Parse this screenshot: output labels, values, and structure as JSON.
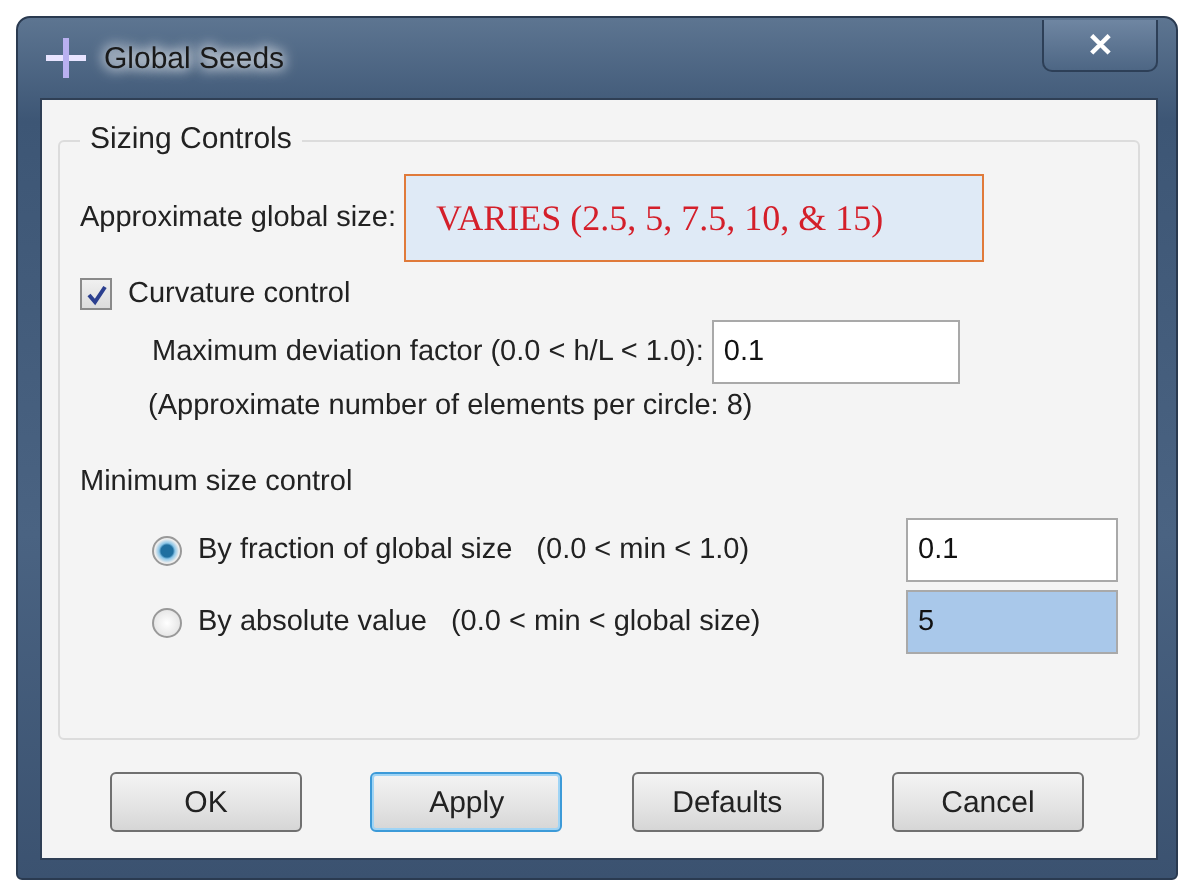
{
  "window": {
    "title": "Global Seeds",
    "close": "✕"
  },
  "sizing_controls": {
    "title": "Sizing Controls",
    "global_size": {
      "label": "Approximate global size:",
      "value": "VARIES (2.5, 5, 7.5, 10, & 15)"
    },
    "curvature": {
      "label": "Curvature control",
      "checked": true,
      "deviation_label": "Maximum deviation factor (0.0 < h/L < 1.0):",
      "deviation_value": "0.1",
      "note": "(Approximate number of elements per circle: 8)"
    },
    "minimum": {
      "label": "Minimum size control",
      "options": [
        {
          "label": "By fraction of global size",
          "range": "(0.0 < min < 1.0)",
          "value": "0.1",
          "selected": true,
          "highlighted": false
        },
        {
          "label": "By absolute value",
          "range": "(0.0 < min < global size)",
          "value": "5",
          "selected": false,
          "highlighted": true
        }
      ]
    }
  },
  "buttons": [
    {
      "label": "OK",
      "focused": false
    },
    {
      "label": "Apply",
      "focused": true
    },
    {
      "label": "Defaults",
      "focused": false
    },
    {
      "label": "Cancel",
      "focused": false
    }
  ]
}
